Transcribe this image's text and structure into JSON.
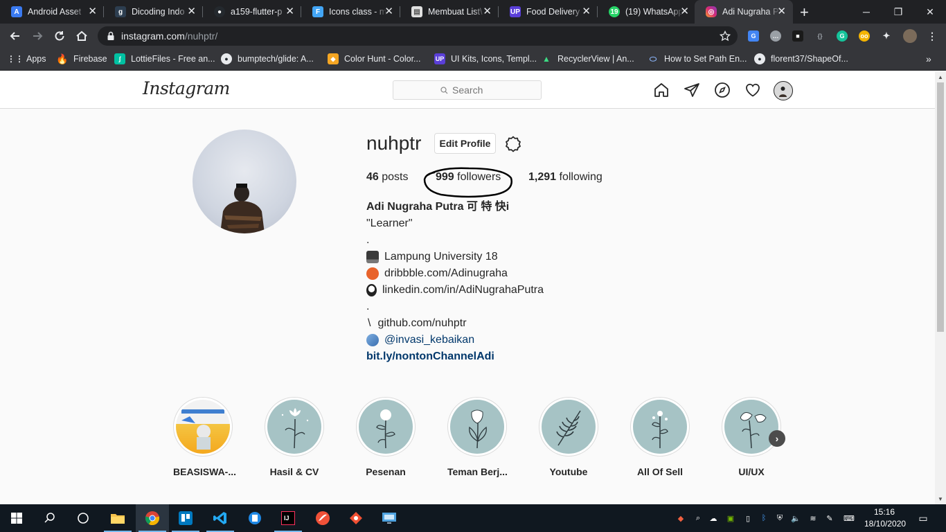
{
  "browser": {
    "tabs": [
      {
        "title": "Android Asset",
        "icon": "android-asset-icon",
        "color": "#3a7af0"
      },
      {
        "title": "Dicoding Indo",
        "icon": "dicoding-icon",
        "color": "#2d3e50"
      },
      {
        "title": "a159-flutter-p",
        "icon": "github-icon",
        "color": "#24292e"
      },
      {
        "title": "Icons class - m",
        "icon": "flutter-icon",
        "color": "#42a5f5"
      },
      {
        "title": "Membuat List\\",
        "icon": "page-icon",
        "color": "#e0e0e0"
      },
      {
        "title": "Food Delivery",
        "icon": "uplabs-icon",
        "color": "#5a3fd8"
      },
      {
        "title": "(19) WhatsApp",
        "icon": "whatsapp-icon",
        "color": "#25d366"
      },
      {
        "title": "Adi Nugraha P",
        "icon": "instagram-icon",
        "color": "#d62976"
      }
    ],
    "url_host": "instagram.com",
    "url_path": "/nuhptr/",
    "bookmarks": [
      {
        "label": "Apps",
        "icon": "apps-grid-icon",
        "color": "#e53935"
      },
      {
        "label": "Firebase",
        "icon": "firebase-icon",
        "color": "#ffa000"
      },
      {
        "label": "LottieFiles - Free an...",
        "icon": "lottiefiles-icon",
        "color": "#00c1a2"
      },
      {
        "label": "bumptech/glide: A...",
        "icon": "github-icon",
        "color": "#24292e"
      },
      {
        "label": "Color Hunt - Color...",
        "icon": "colorhunt-icon",
        "color": "#f5a623"
      },
      {
        "label": "UI Kits, Icons, Templ...",
        "icon": "uplabs-icon",
        "color": "#5a3fd8"
      },
      {
        "label": "RecyclerView | An...",
        "icon": "android-icon",
        "color": "#3ddc84"
      },
      {
        "label": "How to Set Path En...",
        "icon": "path-icon",
        "color": "#8ab4f8"
      },
      {
        "label": "florent37/ShapeOf...",
        "icon": "github-icon",
        "color": "#24292e"
      }
    ]
  },
  "instagram": {
    "logo": "Instagram",
    "search_placeholder": "Search",
    "username": "nuhptr",
    "edit_profile": "Edit Profile",
    "stats": {
      "posts_count": "46",
      "posts_label": " posts",
      "followers_count": "999",
      "followers_label": " followers",
      "following_count": "1,291",
      "following_label": " following"
    },
    "bio": {
      "full_name": "Adi Nugraha Putra 可 特 快i",
      "tagline": "\"Learner\"",
      "dot1": ".",
      "university": "Lampung University 18",
      "dribbble": "dribbble.com/Adinugraha",
      "linkedin": "linkedin.com/in/AdiNugrahaPutra",
      "dot2": ".",
      "github_prefix": "\\",
      "github": "github.com/nuhptr",
      "mention": "@invasi_kebaikan",
      "link": "bit.ly/nontonChannelAdi"
    },
    "highlights": [
      {
        "label": "BEASISWA-..."
      },
      {
        "label": "Hasil & CV"
      },
      {
        "label": "Pesenan"
      },
      {
        "label": "Teman Berj..."
      },
      {
        "label": "Youtube"
      },
      {
        "label": "All Of Sell"
      },
      {
        "label": "UI/UX"
      }
    ]
  },
  "taskbar": {
    "clock_time": "15:16",
    "clock_date": "18/10/2020"
  },
  "colors": {
    "chrome_dark": "#202124",
    "chrome_toolbar": "#35363a",
    "ig_link": "#00376b",
    "ig_text": "#262626",
    "highlight_bg": "#a6c3c5"
  }
}
